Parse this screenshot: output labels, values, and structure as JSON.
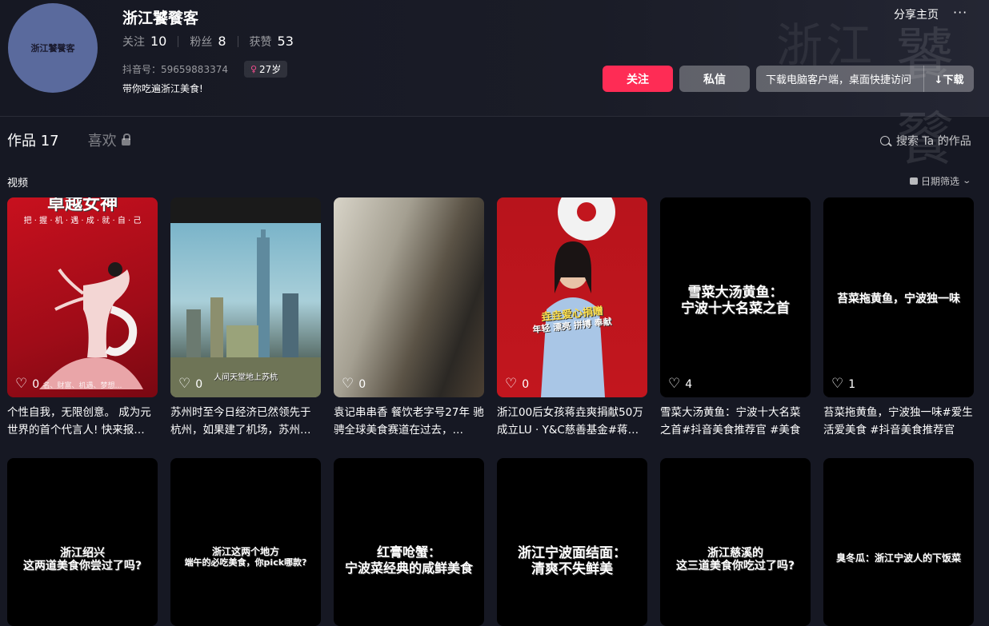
{
  "profile": {
    "avatar_text": "浙江饕餮客",
    "nickname": "浙江饕餮客",
    "following_label": "关注",
    "following": "10",
    "fans_label": "粉丝",
    "fans": "8",
    "likes_label": "获赞",
    "likes": "53",
    "douyin_id": "抖音号：59659883374",
    "age": "27岁",
    "bio": "带你吃遍浙江美食!",
    "bg_text_1": "浙江",
    "bg_text_2": "饕餮"
  },
  "actions": {
    "share": "分享主页",
    "more": "···",
    "follow": "关注",
    "message": "私信",
    "download_text": "下载电脑客户端，桌面快捷访问",
    "download_button": "↓下载"
  },
  "tabs": {
    "works": "作品 17",
    "likes": "喜欢"
  },
  "search": {
    "placeholder": "搜索 Ta 的作品"
  },
  "section": {
    "title": "视频",
    "date_filter": "日期筛选"
  },
  "videos": [
    {
      "likes": "0",
      "desc": "个性自我，无限创意。 成为元世界的首个代言人! 快来报…",
      "cap1": "卓越女神",
      "cap2": "把 · 握 · 机 · 遇 · 成 · 就 · 自 · 己",
      "cap3": "名、财富、机遇、梦想…"
    },
    {
      "likes": "0",
      "desc": "苏州时至今日经济已然领先于杭州，如果建了机场，苏州…",
      "cap1": "人间天堂地上苏杭"
    },
    {
      "likes": "0",
      "desc": "袁记串串香 餐饮老字号27年 驰骋全球美食赛道在过去，…"
    },
    {
      "likes": "0",
      "desc": "浙江00后女孩蒋垚爽捐献50万成立LU · Y&C慈善基金#蒋…",
      "cap1": "垚垚爱心捐赠",
      "cap2": "年轻 漂亮 拼搏 奉献"
    },
    {
      "likes": "4",
      "desc": "雪菜大汤黄鱼：宁波十大名菜之首#抖音美食推荐官 #美食",
      "cap1": "雪菜大汤黄鱼：",
      "cap2": "宁波十大名菜之首"
    },
    {
      "likes": "1",
      "desc": "苔菜拖黄鱼，宁波独一味#爱生活爱美食 #抖音美食推荐官",
      "cap1": "苔菜拖黄鱼，宁波独一味"
    },
    {
      "cap1": "浙江绍兴",
      "cap2": "这两道美食你尝过了吗?"
    },
    {
      "cap1": "浙江这两个地方",
      "cap2": "端午的必吃美食，你pick哪款?"
    },
    {
      "cap1": "红膏呛蟹：",
      "cap2": "宁波菜经典的咸鲜美食"
    },
    {
      "cap1": "浙江宁波面结面：",
      "cap2": "清爽不失鲜美"
    },
    {
      "cap1": "浙江慈溪的",
      "cap2": "这三道美食你吃过了吗?"
    },
    {
      "cap1": "臭冬瓜：浙江宁波人的下饭菜"
    }
  ]
}
